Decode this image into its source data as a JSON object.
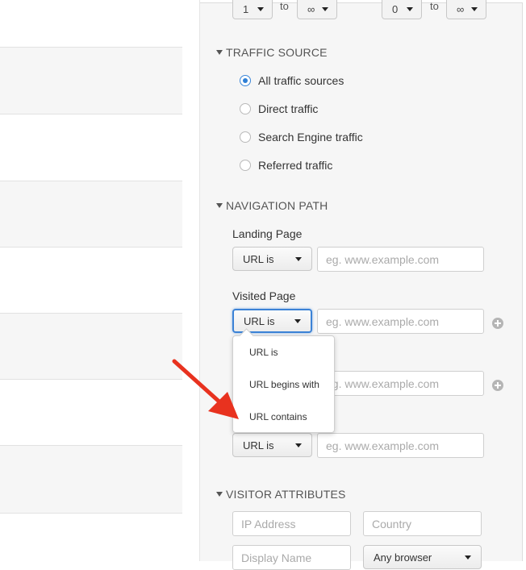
{
  "top_filters": {
    "left_from": "1",
    "left_to_label": "to",
    "left_to": "∞",
    "right_from": "0",
    "right_to_label": "to",
    "right_to": "∞"
  },
  "traffic_source": {
    "heading": "TRAFFIC SOURCE",
    "options": [
      {
        "label": "All traffic sources",
        "selected": true
      },
      {
        "label": "Direct traffic",
        "selected": false
      },
      {
        "label": "Search Engine traffic",
        "selected": false
      },
      {
        "label": "Referred traffic",
        "selected": false
      }
    ]
  },
  "navigation_path": {
    "heading": "NAVIGATION PATH",
    "landing_label": "Landing Page",
    "landing_select": "URL is",
    "landing_placeholder": "eg. www.example.com",
    "visited_label": "Visited Page",
    "visited_select": "URL is",
    "visited_placeholder": "eg. www.example.com",
    "third_placeholder": "eg. www.example.com",
    "fourth_select": "URL is",
    "fourth_placeholder": "eg. www.example.com",
    "dropdown_options": [
      "URL is",
      "URL begins with",
      "URL contains"
    ]
  },
  "visitor_attributes": {
    "heading": "VISITOR ATTRIBUTES",
    "ip_placeholder": "IP Address",
    "country_placeholder": "Country",
    "display_name_placeholder": "Display Name",
    "browser_select": "Any browser"
  },
  "colors": {
    "accent": "#3b82d6",
    "annotation_arrow": "#e8321f",
    "panel_bg": "#f6f6f6"
  }
}
